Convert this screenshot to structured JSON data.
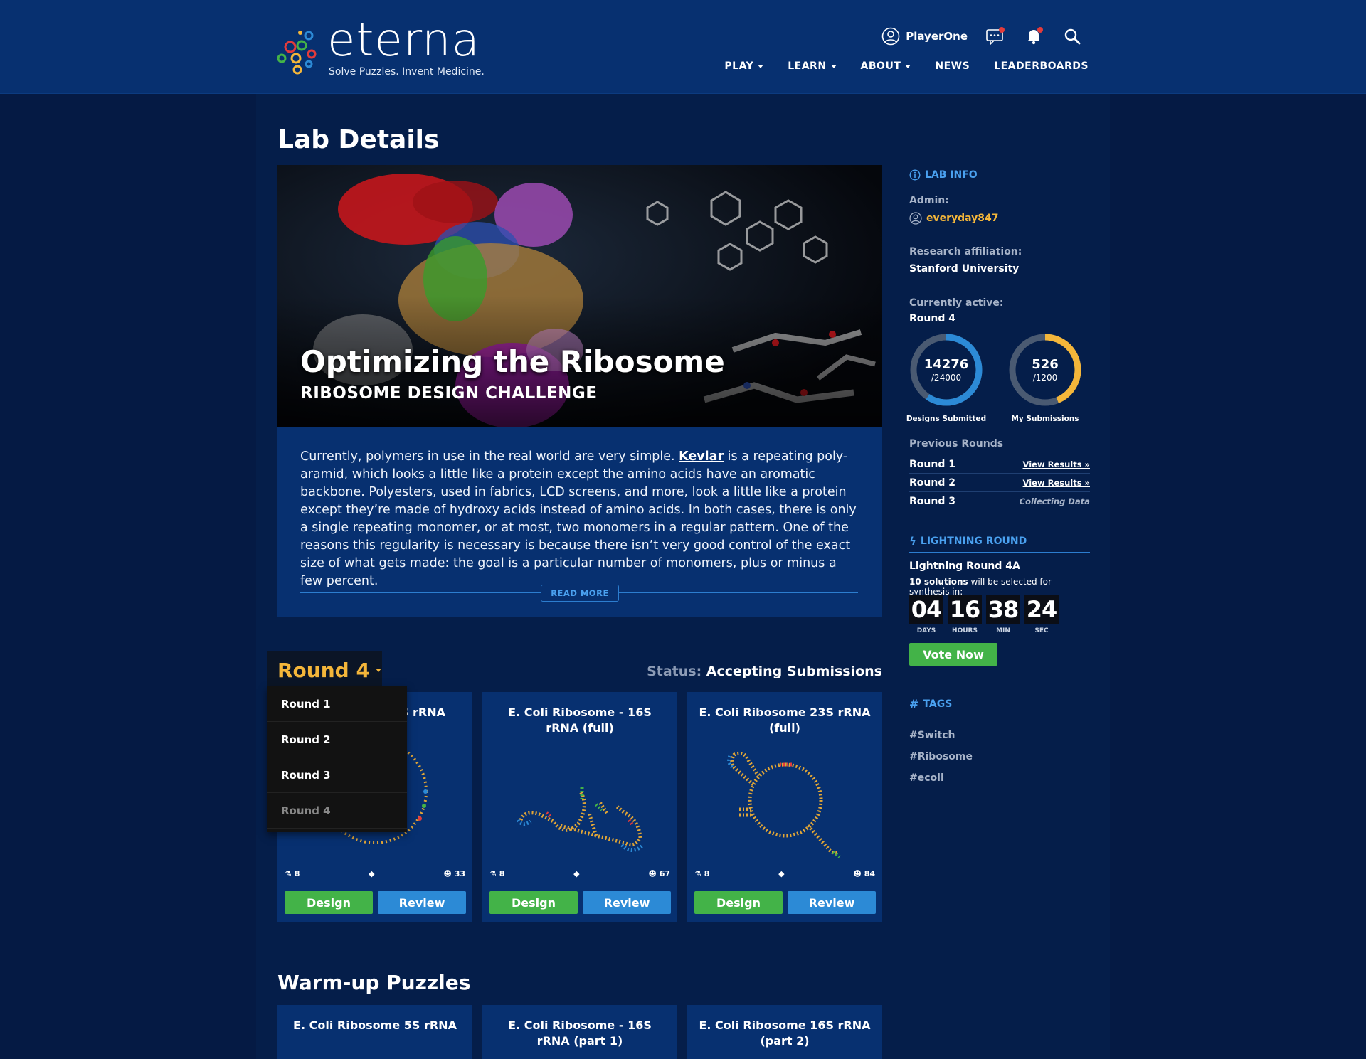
{
  "header": {
    "logo_word": "eterna",
    "logo_tagline": "Solve Puzzles. Invent Medicine.",
    "user_name": "PlayerOne",
    "nav": [
      {
        "label": "PLAY",
        "has_menu": true
      },
      {
        "label": "LEARN",
        "has_menu": true
      },
      {
        "label": "ABOUT",
        "has_menu": true
      },
      {
        "label": "NEWS",
        "has_menu": false
      },
      {
        "label": "LEADERBOARDS",
        "has_menu": false
      }
    ],
    "icons": [
      "user-icon",
      "chat-icon",
      "bell-icon",
      "search-icon"
    ]
  },
  "page_title": "Lab Details",
  "hero": {
    "title": "Optimizing the Ribosome",
    "subtitle": "RIBOSOME DESIGN CHALLENGE"
  },
  "description": {
    "before_link": "Currently, polymers in use in the real world are very simple. ",
    "link": "Kevlar",
    "after_link": " is a repeating poly-aramid, which looks a little like a protein except the amino acids have an aromatic backbone. Polyesters, used in fabrics, LCD screens, and more, look a little like a protein except they’re made of hydroxy acids instead of amino acids. In both cases, there is only a single repeating monomer, or at most, two monomers in a regular pattern. One of the reasons this regularity is necessary is because there isn’t very good control of the exact size of what gets made: the goal is a particular number of monomers, plus or minus a few percent.",
    "read_more": "READ MORE"
  },
  "round_selector": {
    "current": "Round 4",
    "options": [
      "Round 1",
      "Round 2",
      "Round 3",
      "Round 4"
    ]
  },
  "status": {
    "label": "Status:",
    "value": "Accepting Submissions"
  },
  "puzzles": [
    {
      "title_visible": "S rRNA",
      "flask": "8",
      "users": "33",
      "design": "Design",
      "review": "Review"
    },
    {
      "title": "E. Coli Ribosome - 16S rRNA (full)",
      "flask": "8",
      "users": "67",
      "design": "Design",
      "review": "Review"
    },
    {
      "title": "E. Coli Ribosome 23S rRNA (full)",
      "flask": "8",
      "users": "84",
      "design": "Design",
      "review": "Review"
    }
  ],
  "warmup": {
    "title": "Warm-up Puzzles",
    "cards": [
      {
        "title": "E. Coli Ribosome 5S rRNA"
      },
      {
        "title": "E. Coli Ribosome - 16S rRNA (part 1)"
      },
      {
        "title": "E. Coli Ribosome  16S rRNA (part 2)"
      }
    ]
  },
  "sidebar": {
    "lab_info": "LAB INFO",
    "admin_label": "Admin:",
    "admin_name": "everyday847",
    "affiliation_label": "Research affiliation:",
    "affiliation": "Stanford University",
    "active_label": "Currently active:",
    "active_round": "Round 4",
    "gauges": [
      {
        "value": "14276",
        "total": "/24000",
        "fraction": 0.595,
        "label": "Designs Submitted",
        "color": "#2c8ad6"
      },
      {
        "value": "526",
        "total": "/1200",
        "fraction": 0.438,
        "label": "My Submissions",
        "color": "#f4b63a"
      }
    ],
    "previous_label": "Previous Rounds",
    "previous": [
      {
        "round": "Round 1",
        "action": "View Results »"
      },
      {
        "round": "Round 2",
        "action": "View Results »"
      },
      {
        "round": "Round 3",
        "action": "Collecting Data"
      }
    ],
    "lightning_header": "LIGHTNING ROUND",
    "lightning_name": "Lightning Round 4A",
    "lightning_desc_bold": "10 solutions",
    "lightning_desc_rest": " will be selected for synthesis in:",
    "countdown": [
      {
        "value": "04",
        "unit": "DAYS"
      },
      {
        "value": "16",
        "unit": "HOURS"
      },
      {
        "value": "38",
        "unit": "MIN"
      },
      {
        "value": "24",
        "unit": "SEC"
      }
    ],
    "vote_label": "Vote Now",
    "tags_header": "TAGS",
    "tags": [
      "#Switch",
      "#Ribosome",
      "#ecoli"
    ]
  },
  "colors": {
    "header_bg": "#073070",
    "page_bg": "#051a44",
    "panel_bg": "#073070",
    "accent_blue": "#2c8ad6",
    "accent_gold": "#f4b63a",
    "green": "#43b348"
  }
}
